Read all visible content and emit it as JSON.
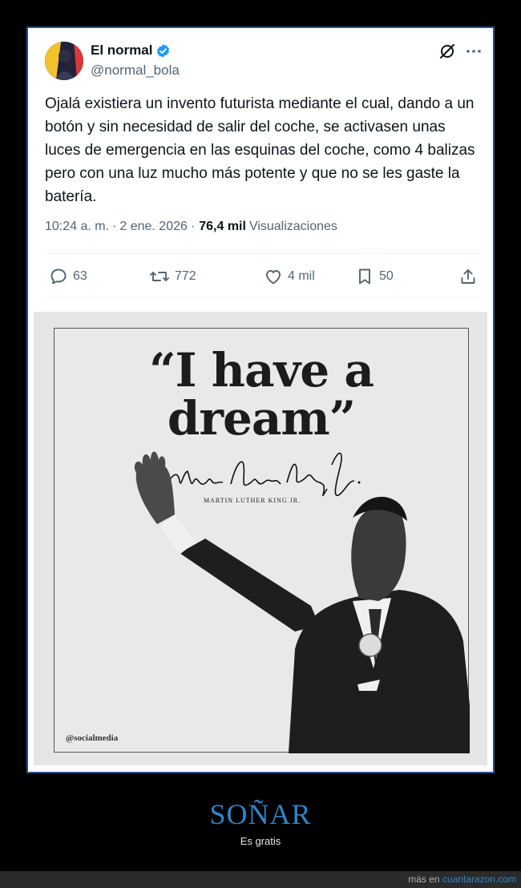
{
  "tweet": {
    "display_name": "El normal",
    "handle": "@normal_bola",
    "text": "Ojalá existiera un invento futurista mediante el cual, dando a un botón y sin necesidad de salir del coche, se activasen unas luces de emergencia en las esquinas del coche, como 4 balizas pero con una luz mucho más potente y que no se les gaste la batería.",
    "time": "10:24 a. m.",
    "date": "2 ene. 2026",
    "separator": "·",
    "views_count": "76,4 mil",
    "views_label": "Visualizaciones",
    "actions": {
      "replies": "63",
      "reposts": "772",
      "likes": "4 mil",
      "bookmarks": "50"
    },
    "icons": [
      "verified-badge-icon",
      "grok-icon",
      "more-icon",
      "reply-icon",
      "repost-icon",
      "like-icon",
      "bookmark-icon",
      "share-icon"
    ],
    "accent_color": "#1d9bf0"
  },
  "image": {
    "quote": "“I have a dream”",
    "signature_caption": "MARTIN LUTHER KING JR.",
    "credit": "@socialmedia"
  },
  "caption": {
    "title": "SOÑAR",
    "subtitle": "Es gratis"
  },
  "footer": {
    "prefix": "más en",
    "site": "cuantarazon.com"
  },
  "colors": {
    "frame_border": "#2a4f82",
    "caption_title": "#2c86c9",
    "background": "#000000"
  }
}
